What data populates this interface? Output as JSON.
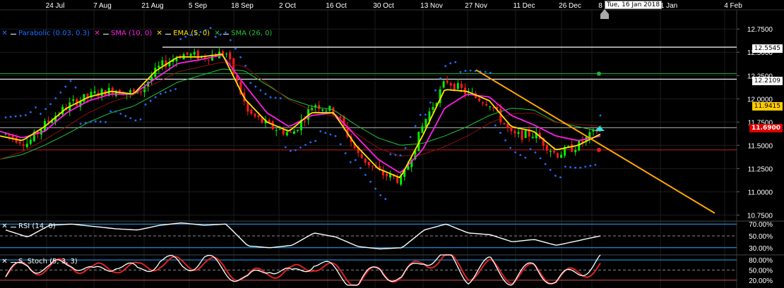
{
  "colors": {
    "bg": "#000000",
    "up": "#00ee00",
    "down": "#ff1a1a",
    "parabolic": "#1e6cff",
    "sma10": "#ff1fe6",
    "ema5": "#ffe600",
    "sma26": "#22c33a",
    "trendline": "#ffa500",
    "grid": "#1c1c1c",
    "rsi": "#ffffff",
    "stoch_k": "#ffffff",
    "stoch_d": "#dd2222",
    "level_line": "#22aaff"
  },
  "dates": [
    "24 Jul",
    "7 Aug",
    "21 Aug",
    "5 Sep",
    "18 Sep",
    "2 Oct",
    "16 Oct",
    "30 Oct",
    "13 Nov",
    "27 Nov",
    "11 Dec",
    "26 Dec",
    "8",
    "1 Jan",
    "4 Feb"
  ],
  "date_tooltip": "Tue, 16 Jan 2018",
  "legend": {
    "parabolic": "Parabolic (0.03, 0.3)",
    "sma10": "SMA (10, 0)",
    "ema5": "EMA (5, 0)",
    "sma26": "SMA (26, 0)",
    "rsi": "RSI (14, 0)",
    "stoch": "S. Stoch (5, 3, 3)"
  },
  "chart_data": [
    {
      "type": "line",
      "title": "",
      "y_ticks": [
        "12.7500",
        "12.5000",
        "12.2500",
        "12.0000",
        "11.7500",
        "11.5000",
        "11.2500",
        "11.0000",
        "10.7500"
      ],
      "ylim": [
        10.7,
        12.85
      ],
      "price_labels": {
        "upper_resistance": "12.5545",
        "resistance": "12.2109",
        "sma_value": "11.9415",
        "last": "11.6900"
      },
      "horizontal_levels": {
        "white_high": 12.5545,
        "white_low": 12.2109,
        "green": 12.27,
        "red": 11.45,
        "last": 11.69
      },
      "series": [
        {
          "name": "Price",
          "x": [
            "10 Jul",
            "17 Jul",
            "24 Jul",
            "31 Jul",
            "7 Aug",
            "14 Aug",
            "21 Aug",
            "28 Aug",
            "5 Sep",
            "11 Sep",
            "18 Sep",
            "25 Sep",
            "2 Oct",
            "9 Oct",
            "16 Oct",
            "23 Oct",
            "30 Oct",
            "6 Nov",
            "13 Nov",
            "20 Nov",
            "27 Nov",
            "4 Dec",
            "11 Dec",
            "18 Dec",
            "26 Dec",
            "2 Jan",
            "8 Jan",
            "16 Jan"
          ],
          "values": [
            11.62,
            11.52,
            11.78,
            11.95,
            12.05,
            12.1,
            12.05,
            12.35,
            12.48,
            12.45,
            12.5,
            11.85,
            11.7,
            11.62,
            11.95,
            11.85,
            11.4,
            11.2,
            11.12,
            11.75,
            12.2,
            12.05,
            11.95,
            11.6,
            11.62,
            11.4,
            11.5,
            11.69
          ]
        },
        {
          "name": "EMA (5, 0)",
          "values": [
            11.6,
            11.55,
            11.7,
            11.9,
            12.02,
            12.08,
            12.05,
            12.3,
            12.45,
            12.45,
            12.48,
            12.0,
            11.75,
            11.65,
            11.85,
            11.85,
            11.5,
            11.25,
            11.15,
            11.6,
            12.1,
            12.08,
            11.98,
            11.7,
            11.65,
            11.45,
            11.5,
            11.62
          ]
        },
        {
          "name": "SMA (10, 0)",
          "values": [
            11.65,
            11.58,
            11.65,
            11.85,
            11.98,
            12.05,
            12.05,
            12.22,
            12.38,
            12.42,
            12.47,
            12.15,
            11.85,
            11.7,
            11.82,
            11.85,
            11.6,
            11.35,
            11.2,
            11.45,
            11.9,
            12.05,
            12.02,
            11.82,
            11.72,
            11.6,
            11.55,
            11.6
          ]
        },
        {
          "name": "SMA (26, 0)",
          "values": [
            11.35,
            11.4,
            11.5,
            11.62,
            11.75,
            11.85,
            11.92,
            12.05,
            12.18,
            12.25,
            12.32,
            12.3,
            12.15,
            12.0,
            11.92,
            11.88,
            11.72,
            11.58,
            11.5,
            11.52,
            11.6,
            11.7,
            11.82,
            11.9,
            11.88,
            11.75,
            11.7,
            11.65
          ]
        }
      ],
      "trendline": {
        "from": [
          "27 Nov",
          12.31
        ],
        "to": [
          "4 Feb",
          10.77
        ]
      }
    },
    {
      "type": "line",
      "title": "RSI (14, 0)",
      "y_ticks": [
        "70.00%",
        "50.00%",
        "30.00%"
      ],
      "ylim": [
        25,
        75
      ],
      "levels": [
        70,
        50,
        30
      ],
      "values": [
        60,
        48,
        68,
        70,
        66,
        62,
        60,
        68,
        72,
        68,
        70,
        33,
        30,
        34,
        55,
        48,
        32,
        28,
        30,
        60,
        70,
        55,
        52,
        40,
        44,
        34,
        42,
        50
      ]
    },
    {
      "type": "line",
      "title": "S. Stoch (5, 3, 3)",
      "y_ticks": [
        "80.00%",
        "50.00%",
        "20.00%"
      ],
      "ylim": [
        5,
        95
      ],
      "levels": [
        80,
        50,
        20
      ],
      "series": [
        {
          "name": "%K",
          "values": [
            30,
            70,
            50,
            80,
            35,
            75,
            40,
            85,
            60,
            82,
            50,
            15,
            65,
            30,
            80,
            40,
            10,
            55,
            20,
            85,
            90,
            30,
            70,
            20,
            60,
            15,
            45,
            82
          ]
        },
        {
          "name": "%D",
          "values": [
            40,
            60,
            55,
            70,
            45,
            65,
            50,
            75,
            65,
            75,
            55,
            25,
            50,
            40,
            70,
            45,
            20,
            45,
            30,
            75,
            85,
            40,
            60,
            30,
            50,
            25,
            40,
            65
          ]
        }
      ]
    }
  ]
}
